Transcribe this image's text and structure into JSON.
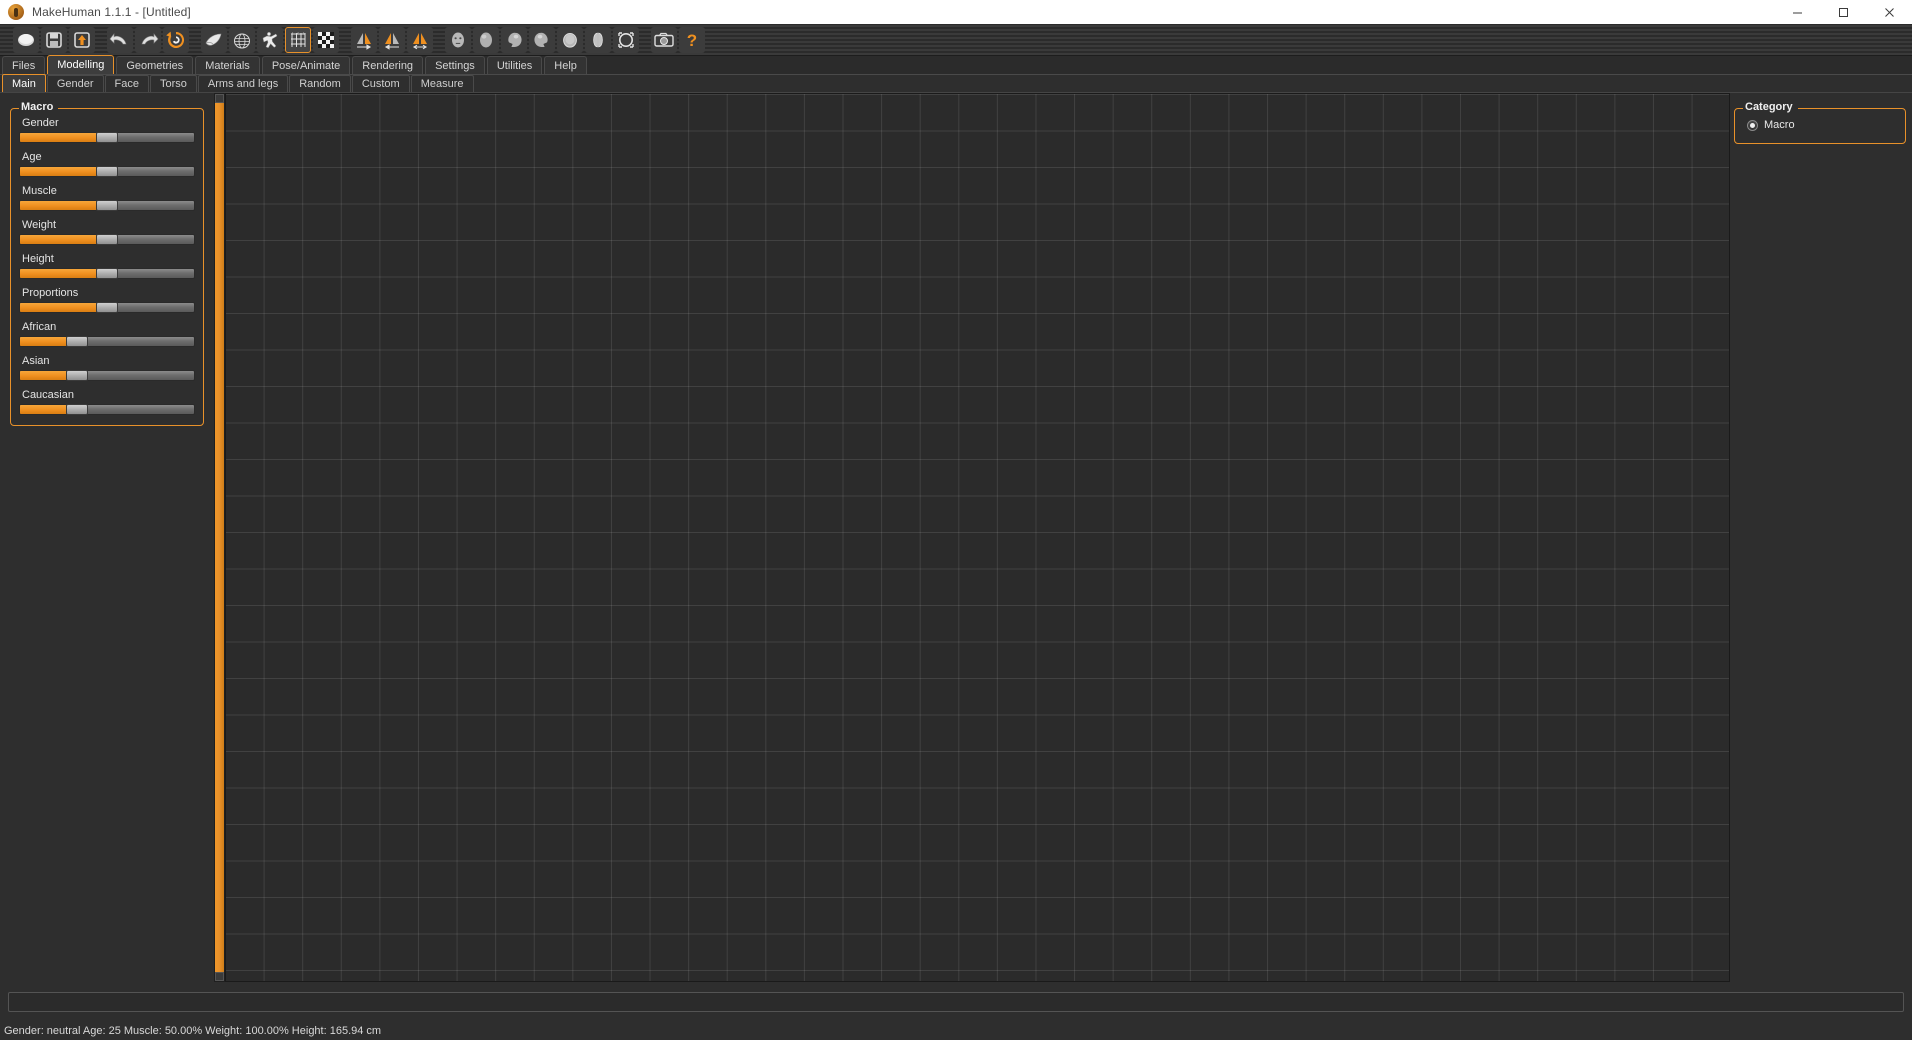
{
  "window": {
    "title": "MakeHuman 1.1.1 - [Untitled]",
    "app_icon": "makehuman-logo-icon",
    "minimize_label": "minimize-icon",
    "maximize_label": "maximize-icon",
    "close_label": "close-icon",
    "accent_color": "#e8912a",
    "background_color": "#2e2e2e",
    "titlebar_color": "#ffffff"
  },
  "toolbar": {
    "groups": [
      {
        "name": "file",
        "buttons": [
          {
            "icon": "new-document-icon",
            "tooltip": "New"
          },
          {
            "icon": "save-floppy-icon",
            "tooltip": "Save"
          },
          {
            "icon": "load-folder-up-arrow-icon",
            "tooltip": "Load"
          }
        ]
      },
      {
        "name": "edit",
        "buttons": [
          {
            "icon": "undo-arrow-icon",
            "tooltip": "Undo"
          },
          {
            "icon": "redo-arrow-icon",
            "tooltip": "Redo"
          },
          {
            "icon": "reset-mesh-icon",
            "tooltip": "Reset mesh"
          }
        ]
      },
      {
        "name": "mesh",
        "buttons": [
          {
            "icon": "smooth-shading-icon",
            "tooltip": "Smooth"
          },
          {
            "icon": "wireframe-globe-icon",
            "tooltip": "Wireframe"
          },
          {
            "icon": "pose-figure-icon",
            "tooltip": "Pose"
          },
          {
            "icon": "grid-icon",
            "tooltip": "Grid",
            "active": true
          },
          {
            "icon": "checkerboard-background-icon",
            "tooltip": "Background"
          }
        ]
      },
      {
        "name": "symmetry",
        "buttons": [
          {
            "icon": "symmetry-right-icon",
            "tooltip": "Symmetry right"
          },
          {
            "icon": "symmetry-left-icon",
            "tooltip": "Symmetry left"
          },
          {
            "icon": "symmetry-both-icon",
            "tooltip": "Symmetry"
          }
        ]
      },
      {
        "name": "camera-views",
        "buttons": [
          {
            "icon": "front-view-face-icon",
            "tooltip": "Front view"
          },
          {
            "icon": "back-view-head-icon",
            "tooltip": "Back view"
          },
          {
            "icon": "left-view-head-icon",
            "tooltip": "Left view"
          },
          {
            "icon": "right-view-head-icon",
            "tooltip": "Right view"
          },
          {
            "icon": "top-view-head-icon",
            "tooltip": "Top view"
          },
          {
            "icon": "side-by-side-view-icon",
            "tooltip": "Bottom view"
          },
          {
            "icon": "reset-camera-icon",
            "tooltip": "Reset camera"
          }
        ]
      },
      {
        "name": "utility",
        "buttons": [
          {
            "icon": "camera-grab-screenshot-icon",
            "tooltip": "Grab screen"
          },
          {
            "icon": "help-question-mark-icon",
            "tooltip": "Help"
          }
        ]
      }
    ]
  },
  "main_tabs": [
    {
      "label": "Files",
      "active": false
    },
    {
      "label": "Modelling",
      "active": true
    },
    {
      "label": "Geometries",
      "active": false
    },
    {
      "label": "Materials",
      "active": false
    },
    {
      "label": "Pose/Animate",
      "active": false
    },
    {
      "label": "Rendering",
      "active": false
    },
    {
      "label": "Settings",
      "active": false
    },
    {
      "label": "Utilities",
      "active": false
    },
    {
      "label": "Help",
      "active": false
    }
  ],
  "sub_tabs": [
    {
      "label": "Main",
      "active": true
    },
    {
      "label": "Gender",
      "active": false
    },
    {
      "label": "Face",
      "active": false
    },
    {
      "label": "Torso",
      "active": false
    },
    {
      "label": "Arms and legs",
      "active": false
    },
    {
      "label": "Random",
      "active": false
    },
    {
      "label": "Custom",
      "active": false
    },
    {
      "label": "Measure",
      "active": false
    }
  ],
  "left_panel": {
    "group_title": "Macro",
    "sliders": [
      {
        "label": "Gender",
        "value": 50
      },
      {
        "label": "Age",
        "value": 50
      },
      {
        "label": "Muscle",
        "value": 50
      },
      {
        "label": "Weight",
        "value": 50
      },
      {
        "label": "Height",
        "value": 50
      },
      {
        "label": "Proportions",
        "value": 50
      },
      {
        "label": "African",
        "value": 33
      },
      {
        "label": "Asian",
        "value": 33
      },
      {
        "label": "Caucasian",
        "value": 33
      }
    ]
  },
  "right_panel": {
    "group_title": "Category",
    "options": [
      {
        "label": "Macro",
        "checked": true
      }
    ]
  },
  "viewport": {
    "scrollbar": "vertical-scrollbar",
    "grid": "on",
    "background_color": "#2b2b2b"
  },
  "progress": {
    "value": 0
  },
  "statusbar": {
    "text": "Gender: neutral Age: 25 Muscle: 50.00% Weight: 100.00% Height: 165.94 cm"
  }
}
